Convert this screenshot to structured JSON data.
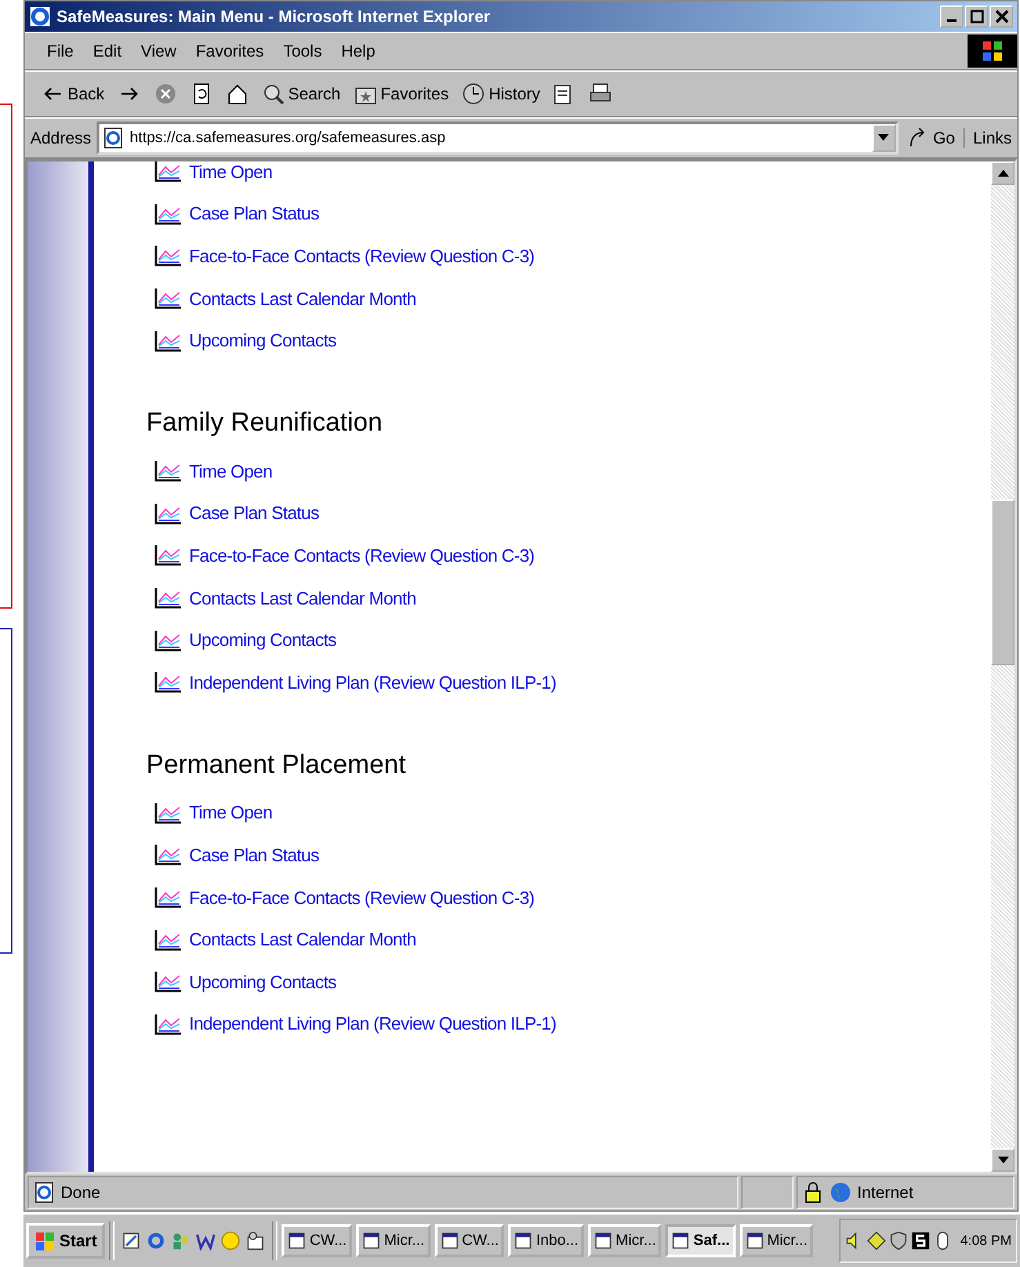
{
  "window": {
    "title": "SafeMeasures: Main Menu - Microsoft Internet Explorer"
  },
  "menu": [
    "File",
    "Edit",
    "View",
    "Favorites",
    "Tools",
    "Help"
  ],
  "toolbar": [
    {
      "kind": "back",
      "label": "Back"
    },
    {
      "kind": "forward"
    },
    {
      "kind": "stop"
    },
    {
      "kind": "refresh"
    },
    {
      "kind": "home"
    },
    {
      "kind": "search",
      "label": "Search"
    },
    {
      "kind": "favorites",
      "label": "Favorites"
    },
    {
      "kind": "history",
      "label": "History"
    },
    {
      "kind": "mail"
    },
    {
      "kind": "print"
    }
  ],
  "address": {
    "label": "Address",
    "value": "https://ca.safemeasures.org/safemeasures.asp",
    "go": "Go",
    "links": "Links"
  },
  "sections": [
    {
      "items": [
        "Time Open",
        "Case Plan Status",
        "Face-to-Face Contacts (Review Question C-3)",
        "Contacts Last Calendar Month",
        "Upcoming Contacts"
      ]
    },
    {
      "heading": "Family Reunification",
      "items": [
        "Time Open",
        "Case Plan Status",
        "Face-to-Face Contacts (Review Question C-3)",
        "Contacts Last Calendar Month",
        "Upcoming Contacts",
        "Independent Living Plan (Review Question ILP-1)"
      ]
    },
    {
      "heading": "Permanent Placement",
      "items": [
        "Time Open",
        "Case Plan Status",
        "Face-to-Face Contacts (Review Question C-3)",
        "Contacts Last Calendar Month",
        "Upcoming Contacts",
        "Independent Living Plan (Review Question ILP-1)"
      ]
    }
  ],
  "status_bar": {
    "text": "Done",
    "zone": "Internet"
  },
  "taskbar": {
    "start": "Start",
    "tasks": [
      {
        "label": "CW...",
        "selected": false
      },
      {
        "label": "Micr...",
        "selected": false
      },
      {
        "label": "CW...",
        "selected": false
      },
      {
        "label": "Inbo...",
        "selected": false
      },
      {
        "label": "Micr...",
        "selected": false
      },
      {
        "label": "Saf...",
        "selected": true
      },
      {
        "label": "Micr...",
        "selected": false
      }
    ],
    "clock": "4:08 PM"
  }
}
